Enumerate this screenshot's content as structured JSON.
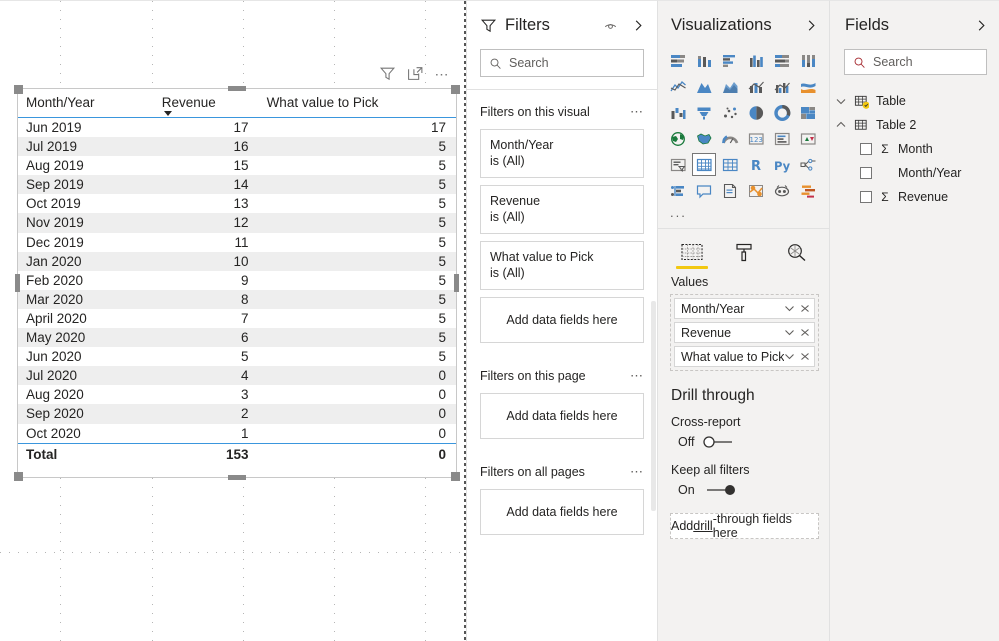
{
  "canvas": {
    "visual_icons": [
      "filter-icon",
      "focus-mode-icon",
      "more-options-icon"
    ]
  },
  "table_visual": {
    "columns": [
      "Month/Year",
      "Revenue",
      "What value to Pick"
    ],
    "sort_column": "Revenue",
    "sort_direction": "descending",
    "rows": [
      {
        "month": "Jun 2019",
        "revenue": "17",
        "pick": "17"
      },
      {
        "month": "Jul 2019",
        "revenue": "16",
        "pick": "5"
      },
      {
        "month": "Aug 2019",
        "revenue": "15",
        "pick": "5"
      },
      {
        "month": "Sep 2019",
        "revenue": "14",
        "pick": "5"
      },
      {
        "month": "Oct 2019",
        "revenue": "13",
        "pick": "5"
      },
      {
        "month": "Nov 2019",
        "revenue": "12",
        "pick": "5"
      },
      {
        "month": "Dec 2019",
        "revenue": "11",
        "pick": "5"
      },
      {
        "month": "Jan 2020",
        "revenue": "10",
        "pick": "5"
      },
      {
        "month": "Feb 2020",
        "revenue": "9",
        "pick": "5"
      },
      {
        "month": "Mar 2020",
        "revenue": "8",
        "pick": "5"
      },
      {
        "month": "April 2020",
        "revenue": "7",
        "pick": "5"
      },
      {
        "month": "May 2020",
        "revenue": "6",
        "pick": "5"
      },
      {
        "month": "Jun 2020",
        "revenue": "5",
        "pick": "5"
      },
      {
        "month": "Jul 2020",
        "revenue": "4",
        "pick": "0"
      },
      {
        "month": "Aug 2020",
        "revenue": "3",
        "pick": "0"
      },
      {
        "month": "Sep 2020",
        "revenue": "2",
        "pick": "0"
      },
      {
        "month": "Oct 2020",
        "revenue": "1",
        "pick": "0"
      }
    ],
    "total": {
      "label": "Total",
      "revenue": "153",
      "pick": "0"
    }
  },
  "filters_pane": {
    "title": "Filters",
    "search_placeholder": "Search",
    "groups": [
      {
        "title": "Filters on this visual",
        "cards": [
          {
            "field": "Month/Year",
            "state": "is (All)"
          },
          {
            "field": "Revenue",
            "state": "is (All)"
          },
          {
            "field": "What value to Pick",
            "state": "is (All)"
          }
        ],
        "drop_label": "Add data fields here"
      },
      {
        "title": "Filters on this page",
        "cards": [],
        "drop_label": "Add data fields here"
      },
      {
        "title": "Filters on all pages",
        "cards": [],
        "drop_label": "Add data fields here"
      }
    ]
  },
  "visualizations_pane": {
    "title": "Visualizations",
    "icons": [
      "stacked-bar-chart-icon",
      "stacked-column-chart-icon",
      "clustered-bar-chart-icon",
      "clustered-column-chart-icon",
      "100-stacked-bar-chart-icon",
      "100-stacked-column-chart-icon",
      "line-chart-icon",
      "area-chart-icon",
      "stacked-area-chart-icon",
      "line-and-stacked-column-chart-icon",
      "line-and-clustered-column-chart-icon",
      "ribbon-chart-icon",
      "waterfall-chart-icon",
      "funnel-chart-icon",
      "scatter-chart-icon",
      "pie-chart-icon",
      "donut-chart-icon",
      "treemap-icon",
      "map-icon",
      "filled-map-icon",
      "gauge-icon",
      "card-icon",
      "multi-row-card-icon",
      "kpi-icon",
      "slicer-icon",
      "table-icon",
      "matrix-icon",
      "r-script-visual-icon",
      "python-visual-icon",
      "decomposition-tree-icon",
      "key-influencers-icon",
      "qa-visual-icon",
      "paginated-report-icon",
      "arcgis-maps-icon",
      "smart-narrative-icon",
      "gantt-icon"
    ],
    "selected_icon": "table-icon",
    "more_label": "...",
    "tabs": [
      {
        "name": "fields-tab",
        "icon": "fields-icon",
        "selected": true
      },
      {
        "name": "format-tab",
        "icon": "paint-roller-icon",
        "selected": false
      },
      {
        "name": "analytics-tab",
        "icon": "magnifier-icon",
        "selected": false
      }
    ],
    "well_title": "Values",
    "well_fields": [
      "Month/Year",
      "Revenue",
      "What value to Pick"
    ],
    "drill_through": {
      "title": "Drill through",
      "cross_report_label": "Cross-report",
      "cross_report_state": "Off",
      "keep_filters_label": "Keep all filters",
      "keep_filters_state": "On",
      "drop_label_prefix": "Add ",
      "drop_label_underlined": "drill",
      "drop_label_suffix": "-through fields here"
    }
  },
  "fields_pane": {
    "title": "Fields",
    "search_placeholder": "Search",
    "tables": [
      {
        "name": "Table",
        "expanded": false,
        "has_badge": true,
        "fields": []
      },
      {
        "name": "Table 2",
        "expanded": true,
        "has_badge": false,
        "fields": [
          {
            "label": "Month",
            "aggregate": true,
            "checked": false
          },
          {
            "label": "Month/Year",
            "aggregate": false,
            "checked": false
          },
          {
            "label": "Revenue",
            "aggregate": true,
            "checked": false
          }
        ]
      }
    ]
  },
  "colors": {
    "accent_blue": "#3a96dd",
    "yellow": "#f2c811",
    "pane_bg": "#f3f2f1",
    "alt_row": "#eeeeee"
  }
}
